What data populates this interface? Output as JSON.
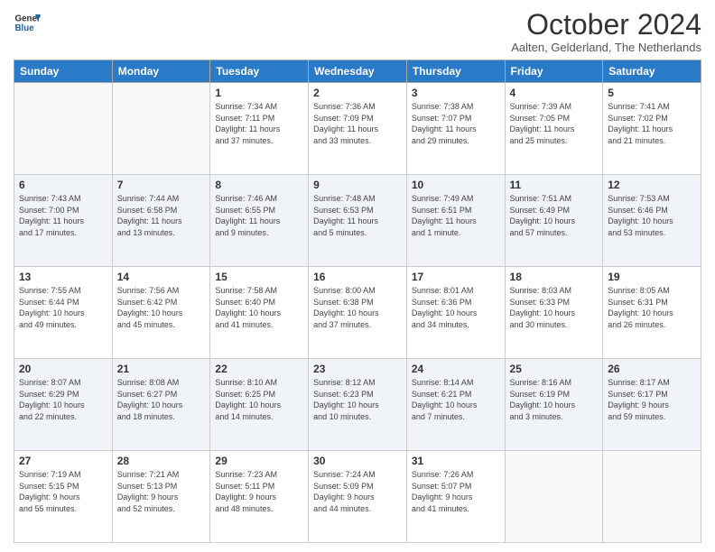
{
  "logo": {
    "line1": "General",
    "line2": "Blue"
  },
  "title": "October 2024",
  "location": "Aalten, Gelderland, The Netherlands",
  "weekdays": [
    "Sunday",
    "Monday",
    "Tuesday",
    "Wednesday",
    "Thursday",
    "Friday",
    "Saturday"
  ],
  "weeks": [
    [
      {
        "day": "",
        "info": ""
      },
      {
        "day": "",
        "info": ""
      },
      {
        "day": "1",
        "info": "Sunrise: 7:34 AM\nSunset: 7:11 PM\nDaylight: 11 hours\nand 37 minutes."
      },
      {
        "day": "2",
        "info": "Sunrise: 7:36 AM\nSunset: 7:09 PM\nDaylight: 11 hours\nand 33 minutes."
      },
      {
        "day": "3",
        "info": "Sunrise: 7:38 AM\nSunset: 7:07 PM\nDaylight: 11 hours\nand 29 minutes."
      },
      {
        "day": "4",
        "info": "Sunrise: 7:39 AM\nSunset: 7:05 PM\nDaylight: 11 hours\nand 25 minutes."
      },
      {
        "day": "5",
        "info": "Sunrise: 7:41 AM\nSunset: 7:02 PM\nDaylight: 11 hours\nand 21 minutes."
      }
    ],
    [
      {
        "day": "6",
        "info": "Sunrise: 7:43 AM\nSunset: 7:00 PM\nDaylight: 11 hours\nand 17 minutes."
      },
      {
        "day": "7",
        "info": "Sunrise: 7:44 AM\nSunset: 6:58 PM\nDaylight: 11 hours\nand 13 minutes."
      },
      {
        "day": "8",
        "info": "Sunrise: 7:46 AM\nSunset: 6:55 PM\nDaylight: 11 hours\nand 9 minutes."
      },
      {
        "day": "9",
        "info": "Sunrise: 7:48 AM\nSunset: 6:53 PM\nDaylight: 11 hours\nand 5 minutes."
      },
      {
        "day": "10",
        "info": "Sunrise: 7:49 AM\nSunset: 6:51 PM\nDaylight: 11 hours\nand 1 minute."
      },
      {
        "day": "11",
        "info": "Sunrise: 7:51 AM\nSunset: 6:49 PM\nDaylight: 10 hours\nand 57 minutes."
      },
      {
        "day": "12",
        "info": "Sunrise: 7:53 AM\nSunset: 6:46 PM\nDaylight: 10 hours\nand 53 minutes."
      }
    ],
    [
      {
        "day": "13",
        "info": "Sunrise: 7:55 AM\nSunset: 6:44 PM\nDaylight: 10 hours\nand 49 minutes."
      },
      {
        "day": "14",
        "info": "Sunrise: 7:56 AM\nSunset: 6:42 PM\nDaylight: 10 hours\nand 45 minutes."
      },
      {
        "day": "15",
        "info": "Sunrise: 7:58 AM\nSunset: 6:40 PM\nDaylight: 10 hours\nand 41 minutes."
      },
      {
        "day": "16",
        "info": "Sunrise: 8:00 AM\nSunset: 6:38 PM\nDaylight: 10 hours\nand 37 minutes."
      },
      {
        "day": "17",
        "info": "Sunrise: 8:01 AM\nSunset: 6:36 PM\nDaylight: 10 hours\nand 34 minutes."
      },
      {
        "day": "18",
        "info": "Sunrise: 8:03 AM\nSunset: 6:33 PM\nDaylight: 10 hours\nand 30 minutes."
      },
      {
        "day": "19",
        "info": "Sunrise: 8:05 AM\nSunset: 6:31 PM\nDaylight: 10 hours\nand 26 minutes."
      }
    ],
    [
      {
        "day": "20",
        "info": "Sunrise: 8:07 AM\nSunset: 6:29 PM\nDaylight: 10 hours\nand 22 minutes."
      },
      {
        "day": "21",
        "info": "Sunrise: 8:08 AM\nSunset: 6:27 PM\nDaylight: 10 hours\nand 18 minutes."
      },
      {
        "day": "22",
        "info": "Sunrise: 8:10 AM\nSunset: 6:25 PM\nDaylight: 10 hours\nand 14 minutes."
      },
      {
        "day": "23",
        "info": "Sunrise: 8:12 AM\nSunset: 6:23 PM\nDaylight: 10 hours\nand 10 minutes."
      },
      {
        "day": "24",
        "info": "Sunrise: 8:14 AM\nSunset: 6:21 PM\nDaylight: 10 hours\nand 7 minutes."
      },
      {
        "day": "25",
        "info": "Sunrise: 8:16 AM\nSunset: 6:19 PM\nDaylight: 10 hours\nand 3 minutes."
      },
      {
        "day": "26",
        "info": "Sunrise: 8:17 AM\nSunset: 6:17 PM\nDaylight: 9 hours\nand 59 minutes."
      }
    ],
    [
      {
        "day": "27",
        "info": "Sunrise: 7:19 AM\nSunset: 5:15 PM\nDaylight: 9 hours\nand 55 minutes."
      },
      {
        "day": "28",
        "info": "Sunrise: 7:21 AM\nSunset: 5:13 PM\nDaylight: 9 hours\nand 52 minutes."
      },
      {
        "day": "29",
        "info": "Sunrise: 7:23 AM\nSunset: 5:11 PM\nDaylight: 9 hours\nand 48 minutes."
      },
      {
        "day": "30",
        "info": "Sunrise: 7:24 AM\nSunset: 5:09 PM\nDaylight: 9 hours\nand 44 minutes."
      },
      {
        "day": "31",
        "info": "Sunrise: 7:26 AM\nSunset: 5:07 PM\nDaylight: 9 hours\nand 41 minutes."
      },
      {
        "day": "",
        "info": ""
      },
      {
        "day": "",
        "info": ""
      }
    ]
  ]
}
